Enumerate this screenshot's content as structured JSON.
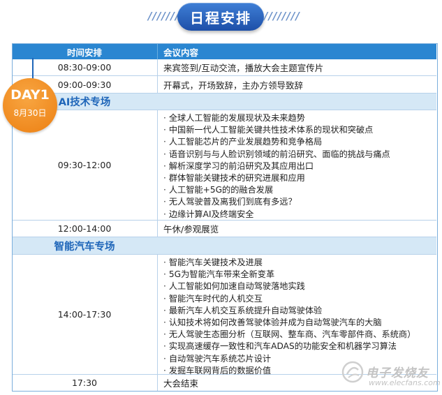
{
  "header": {
    "title": "日程安排",
    "stripes": "////////"
  },
  "badge": {
    "day": "DAY1",
    "date": "8月30日"
  },
  "table": {
    "col_time": "时间安排",
    "col_content": "会议内容"
  },
  "rows": {
    "r1": {
      "time": "08:30-09:00",
      "content": "来宾签到/互动交流，播放大会主题宣传片"
    },
    "r2": {
      "time": "09:00-09:30",
      "content": "开幕式，开场致辞，主办方领导致辞"
    },
    "s1": {
      "title": "AI技术专场"
    },
    "r3": {
      "time": "09:30-12:00",
      "items": [
        "全球人工智能的发展现状及未来趋势",
        "中国新一代人工智能关键共性技术体系的现状和突破点",
        "人工智能芯片的产业发展趋势和竞争格局",
        "语音识别与与人脸识别领域的前沿研究、面临的挑战与痛点",
        "解析深度学习的前沿研究及其应用出口",
        "群体智能关键技术的研究进展和应用",
        "人工智能+5G的的融合发展",
        "无人驾驶普及离我们到底有多远？",
        "边缘计算AI及终端安全"
      ]
    },
    "r4": {
      "time": "12:00-14:00",
      "content": "午休/参观展览"
    },
    "s2": {
      "title": "智能汽车专场"
    },
    "r5": {
      "time": "14:00-17:30",
      "items": [
        "智能汽车关键技术及进展",
        "5G为智能汽车带来全新变革",
        "人工智能如何加速自动驾驶落地实践",
        "智能汽车时代的人机交互",
        "最新汽车人机交互系统提升自动驾驶体验",
        "认知技术将如何改善驾驶体验并成为自动驾驶汽车的大脑",
        "无人驾驶生态圈分析（互联网、整车商、汽车零部件商、系统商）",
        "实现高速缓存一致性和汽车ADAS的功能安全和机器学习算法",
        "自动驾驶汽车系统芯片设计",
        "发掘车联网背后的数据价值"
      ]
    },
    "r6": {
      "time": "17:30",
      "content": "大会结束"
    }
  },
  "watermark": {
    "cn": "电子发烧友",
    "url": "www.elecfans.com"
  }
}
